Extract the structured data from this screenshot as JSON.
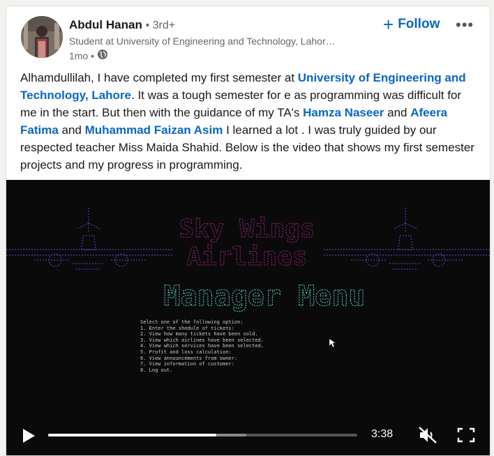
{
  "author": {
    "name": "Abdul Hanan",
    "degree": "• 3rd+",
    "headline": "Student at University of Engineering and Technology, Lahor…",
    "time": "1mo •",
    "visibility_icon": "globe-icon"
  },
  "actions": {
    "follow_label": "Follow",
    "follow_icon": "plus-icon",
    "more_icon": "more-icon"
  },
  "post": {
    "t1": "Alhamdullilah, I have completed my first semester at ",
    "m1": "University of Engineering and Technology, Lahore",
    "t2": ". It was a tough semester for e as programming was difficult for me in the start. But then with the guidance of my TA's ",
    "m2": "Hamza Naseer",
    "t3": " and ",
    "m3": "Afeera Fatima",
    "t4": " and ",
    "m4": "Muhammad Faizan Asim",
    "t5": " I learned a lot . I was truly guided by our respected teacher Miss Maida Shahid. Below is the video that shows my first semester projects and my progress in programming."
  },
  "video": {
    "title_line1": "Sky Wings",
    "title_line2": "Airlines",
    "heading": "Manager Menu",
    "menu_lines": [
      "Select one of the following option:",
      "1. Enter the shedule of tickets:",
      "2. View how many tickets have been sold.",
      "3. View which airlines have been selected.",
      "4. View which services have been selected.",
      "5. Profit and loss calculation:",
      "6. View announcements from owner:",
      "7. View information of customer:",
      "8. Log out."
    ],
    "time_remaining": "3:38",
    "progress_played": 0.545,
    "progress_buffered": 0.64
  },
  "colors": {
    "link": "#0a66c2",
    "video_bg": "#0a0a0a",
    "title_pink": "#8a1f6e",
    "heading_teal": "#4fb8a6",
    "plane_blue": "#4a3fb0"
  }
}
